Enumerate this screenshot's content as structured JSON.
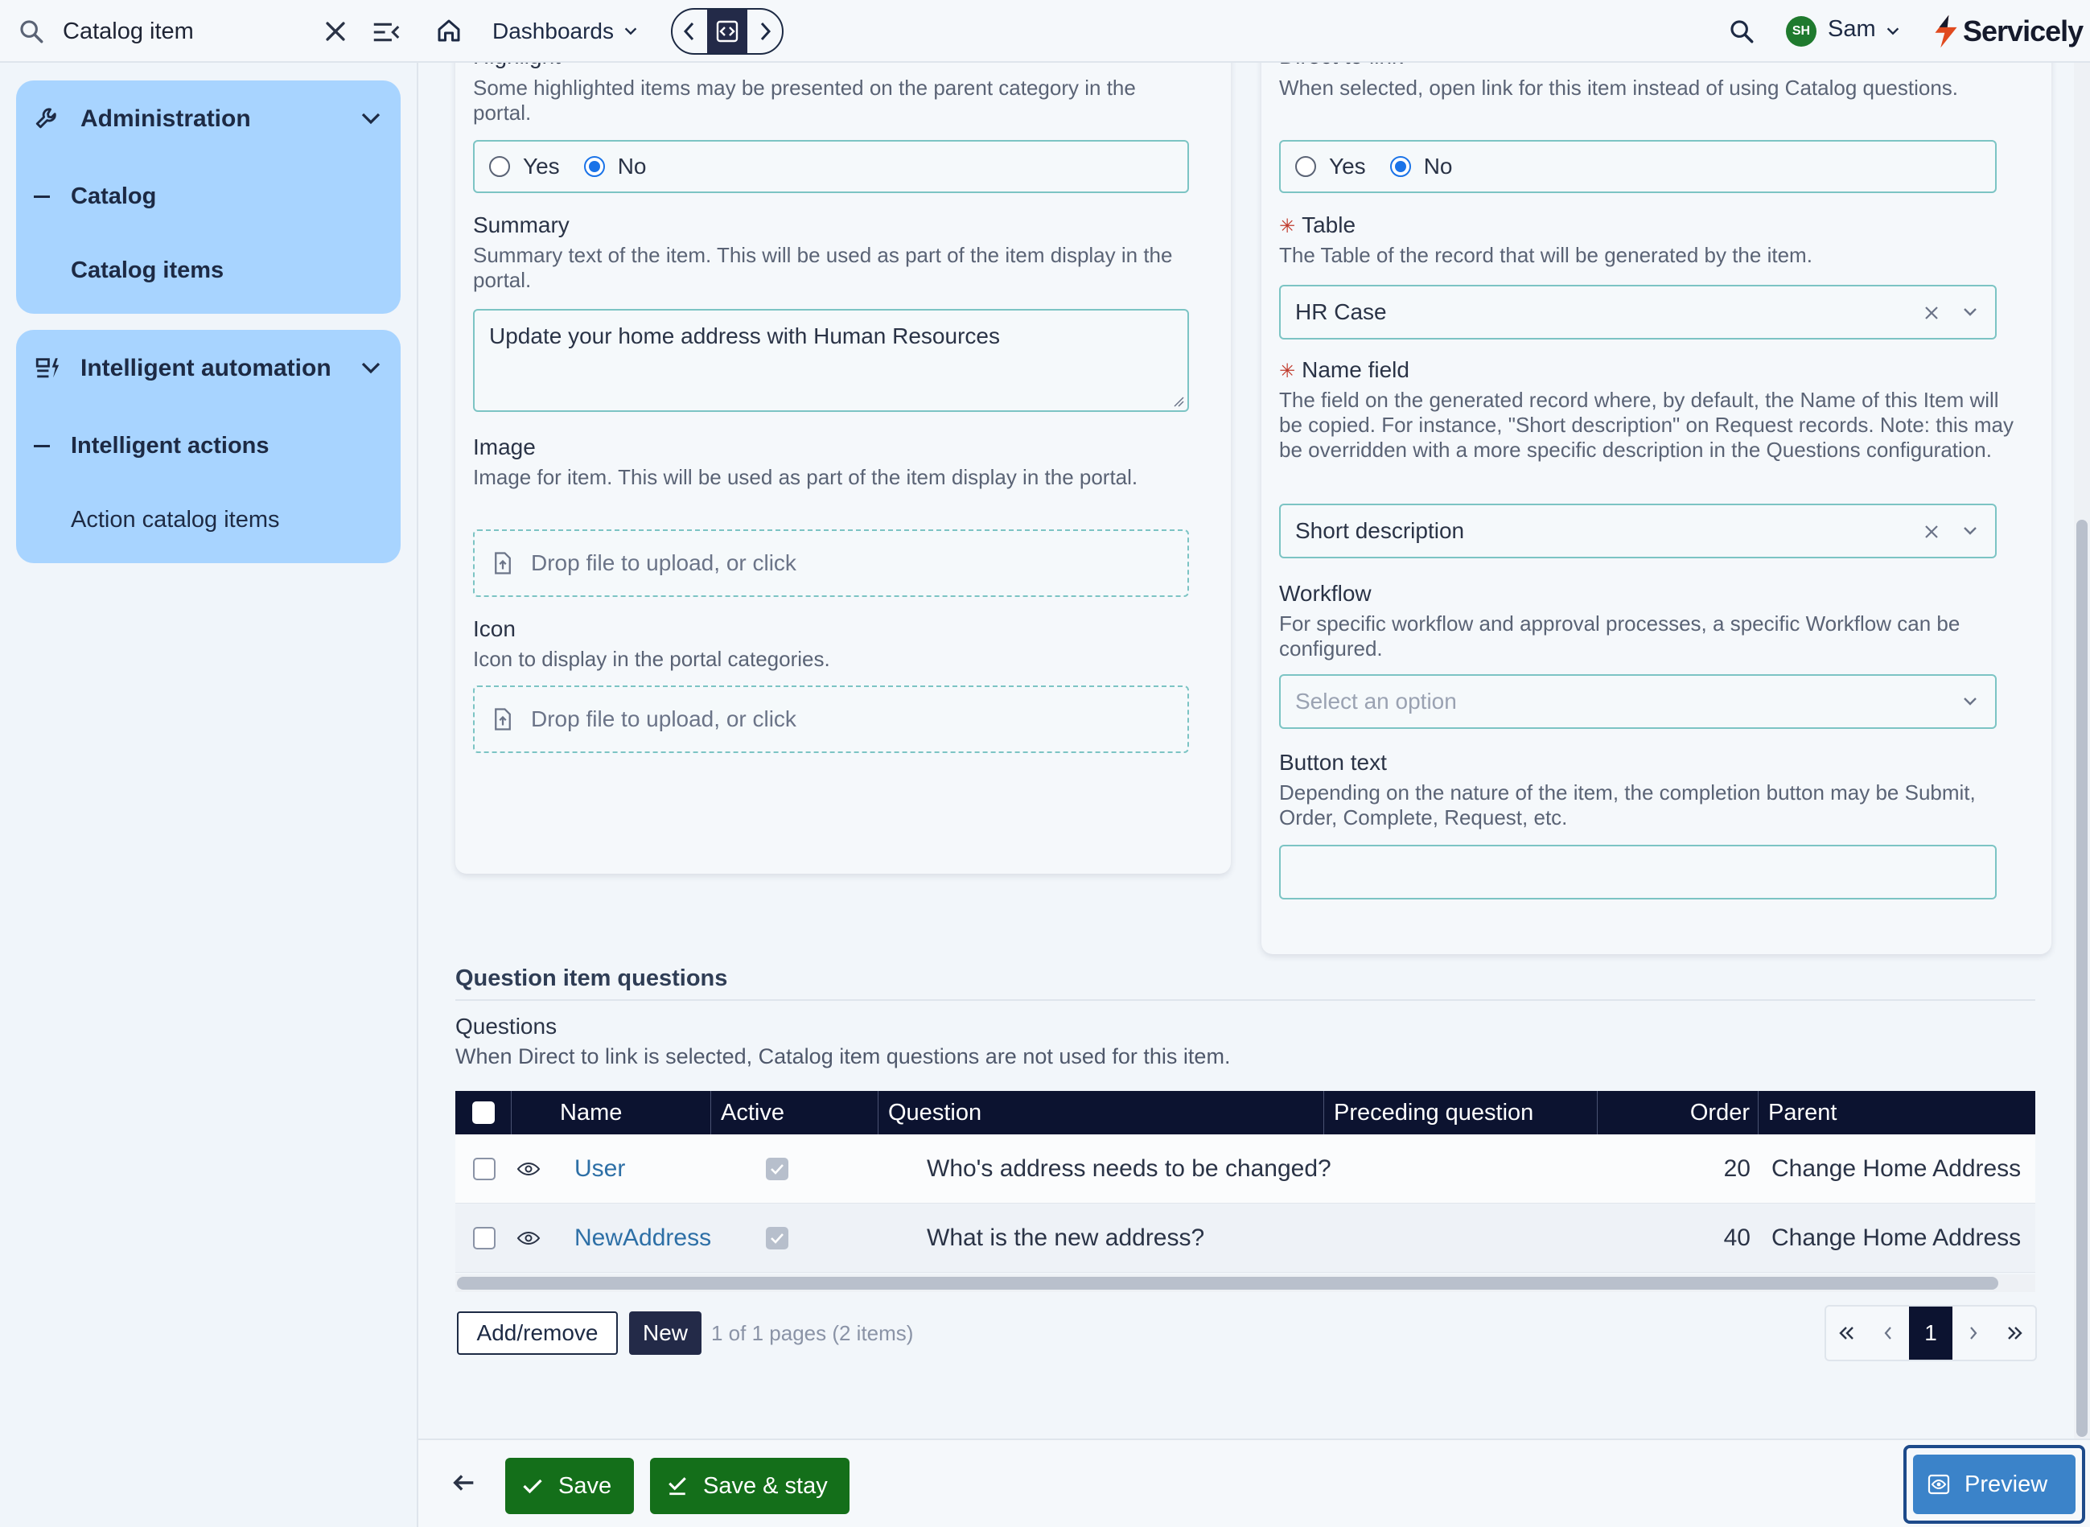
{
  "sidebar": {
    "search_value": "Catalog item",
    "sections": [
      {
        "title": "Administration",
        "group": "Catalog",
        "items": [
          "Catalog items"
        ]
      },
      {
        "title": "Intelligent automation",
        "group": "Intelligent actions",
        "items": [
          "Action catalog items"
        ]
      }
    ]
  },
  "topbar": {
    "dashboards_label": "Dashboards",
    "user_initials": "SH",
    "user_name": "Sam",
    "brand": "Servicely"
  },
  "form": {
    "highlight": {
      "label": "Highlight",
      "description": "Some highlighted items may be presented on the parent category in the portal.",
      "options": [
        "Yes",
        "No"
      ],
      "selected": "No"
    },
    "summary": {
      "label": "Summary",
      "description": "Summary text of the item. This will be used as part of the item display in the portal.",
      "value": "Update your home address with Human Resources"
    },
    "image": {
      "label": "Image",
      "description": "Image for item. This will be used as part of the item display in the portal.",
      "drop_text": "Drop file to upload, or click"
    },
    "icon": {
      "label": "Icon",
      "description": "Icon to display in the portal categories.",
      "drop_text": "Drop file to upload, or click"
    },
    "direct_to_link": {
      "label": "Direct to link",
      "description": "When selected, open link for this item instead of using Catalog questions.",
      "options": [
        "Yes",
        "No"
      ],
      "selected": "No"
    },
    "table": {
      "label": "Table",
      "description": "The Table of the record that will be generated by the item.",
      "value": "HR Case",
      "required": true
    },
    "name_field": {
      "label": "Name field",
      "description": "The field on the generated record where, by default, the Name of this Item will be copied. For instance, \"Short description\" on Request records. Note: this may be overridden with a more specific description in the Questions configuration.",
      "value": "Short description",
      "required": true
    },
    "workflow": {
      "label": "Workflow",
      "description": "For specific workflow and approval processes, a specific Workflow can be configured.",
      "placeholder": "Select an option"
    },
    "button_text": {
      "label": "Button text",
      "description": "Depending on the nature of the item, the completion button may be Submit, Order, Complete, Request, etc.",
      "value": ""
    }
  },
  "questions": {
    "section_title": "Question item questions",
    "label": "Questions",
    "description": "When Direct to link is selected, Catalog item questions are not used for this item.",
    "columns": [
      "Name",
      "Active",
      "Question",
      "Preceding question",
      "Order",
      "Parent"
    ],
    "rows": [
      {
        "name": "User",
        "active": true,
        "question": "Who's address needs to be changed?",
        "preceding": "",
        "order": "20",
        "parent": "Change Home Address"
      },
      {
        "name": "NewAddress",
        "active": true,
        "question": "What is the new address?",
        "preceding": "",
        "order": "40",
        "parent": "Change Home Address"
      }
    ],
    "add_remove_label": "Add/remove",
    "new_label": "New",
    "page_info": "1 of 1 pages (2 items)",
    "current_page": "1"
  },
  "actions": {
    "save_label": "Save",
    "save_stay_label": "Save & stay",
    "preview_label": "Preview"
  },
  "colors": {
    "sidebar_card": "#a8d4ff",
    "table_header": "#0c1330",
    "save_green": "#146f1a",
    "preview_blue": "#3b83c9",
    "field_border": "#7cc4c4"
  }
}
